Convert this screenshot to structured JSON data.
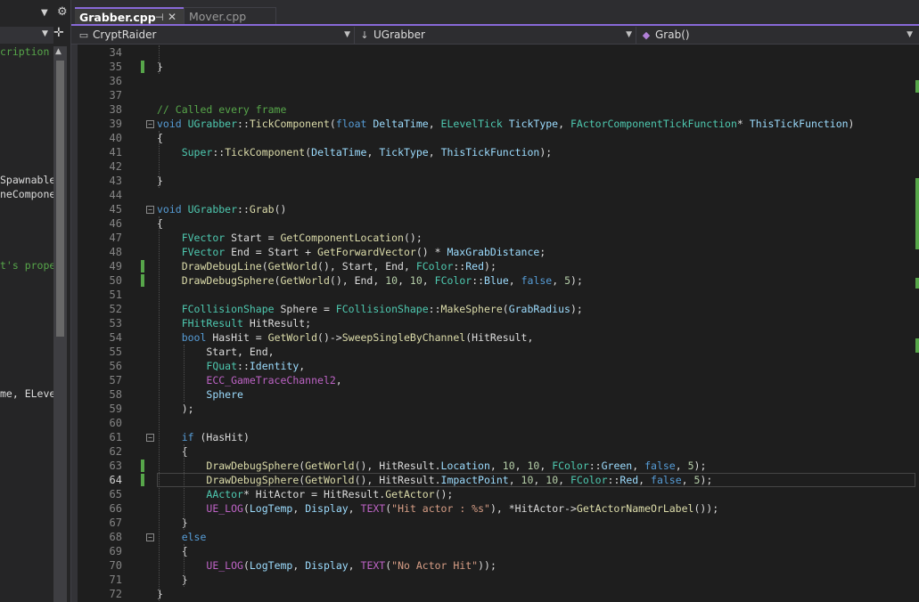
{
  "left_panel": {
    "fragments": [
      {
        "text": "cription",
        "color": "green"
      },
      {
        "text": "Spawnable",
        "color": "light"
      },
      {
        "text": "neCompone",
        "color": "light"
      },
      {
        "text": "t's prope",
        "color": "green"
      },
      {
        "text": "me, ELeve",
        "color": "light"
      }
    ]
  },
  "tabs": [
    {
      "label": "Grabber.cpp",
      "active": true
    },
    {
      "label": "Mover.cpp",
      "active": false
    }
  ],
  "navbar": {
    "project": "CryptRaider",
    "scope": "UGrabber",
    "member": "Grab()"
  },
  "editor": {
    "current_line": 64,
    "lines": [
      {
        "n": 34,
        "tokens": [
          [
            "d",
            ""
          ]
        ]
      },
      {
        "n": 35,
        "tokens": [
          [
            "d",
            "}"
          ]
        ]
      },
      {
        "n": 36,
        "tokens": []
      },
      {
        "n": 37,
        "tokens": []
      },
      {
        "n": 38,
        "tokens": [
          [
            "c",
            "// Called every frame"
          ]
        ]
      },
      {
        "n": 39,
        "tokens": [
          [
            "k",
            "void "
          ],
          [
            "t",
            "UGrabber"
          ],
          [
            "d",
            "::"
          ],
          [
            "f",
            "TickComponent"
          ],
          [
            "d",
            "("
          ],
          [
            "k",
            "float "
          ],
          [
            "p",
            "DeltaTime"
          ],
          [
            "d",
            ", "
          ],
          [
            "t",
            "ELevelTick "
          ],
          [
            "p",
            "TickType"
          ],
          [
            "d",
            ", "
          ],
          [
            "t",
            "FActorComponentTickFunction"
          ],
          [
            "d",
            "* "
          ],
          [
            "p",
            "ThisTickFunction"
          ],
          [
            "d",
            ")"
          ]
        ]
      },
      {
        "n": 40,
        "tokens": [
          [
            "d",
            "{"
          ]
        ]
      },
      {
        "n": 41,
        "tokens": [
          [
            "d",
            "    "
          ],
          [
            "t",
            "Super"
          ],
          [
            "d",
            "::"
          ],
          [
            "f",
            "TickComponent"
          ],
          [
            "d",
            "("
          ],
          [
            "p",
            "DeltaTime"
          ],
          [
            "d",
            ", "
          ],
          [
            "p",
            "TickType"
          ],
          [
            "d",
            ", "
          ],
          [
            "p",
            "ThisTickFunction"
          ],
          [
            "d",
            ");"
          ]
        ]
      },
      {
        "n": 42,
        "tokens": []
      },
      {
        "n": 43,
        "tokens": [
          [
            "d",
            "}"
          ]
        ]
      },
      {
        "n": 44,
        "tokens": []
      },
      {
        "n": 45,
        "tokens": [
          [
            "k",
            "void "
          ],
          [
            "t",
            "UGrabber"
          ],
          [
            "d",
            "::"
          ],
          [
            "f",
            "Grab"
          ],
          [
            "d",
            "()"
          ]
        ]
      },
      {
        "n": 46,
        "tokens": [
          [
            "d",
            "{"
          ]
        ]
      },
      {
        "n": 47,
        "tokens": [
          [
            "d",
            "    "
          ],
          [
            "t",
            "FVector "
          ],
          [
            "d",
            "Start = "
          ],
          [
            "f",
            "GetComponentLocation"
          ],
          [
            "d",
            "();"
          ]
        ]
      },
      {
        "n": 48,
        "tokens": [
          [
            "d",
            "    "
          ],
          [
            "t",
            "FVector "
          ],
          [
            "d",
            "End = Start + "
          ],
          [
            "f",
            "GetForwardVector"
          ],
          [
            "d",
            "() * "
          ],
          [
            "p",
            "MaxGrabDistance"
          ],
          [
            "d",
            ";"
          ]
        ]
      },
      {
        "n": 49,
        "tokens": [
          [
            "d",
            "    "
          ],
          [
            "f",
            "DrawDebugLine"
          ],
          [
            "d",
            "("
          ],
          [
            "f",
            "GetWorld"
          ],
          [
            "d",
            "(), Start, End, "
          ],
          [
            "t",
            "FColor"
          ],
          [
            "d",
            "::"
          ],
          [
            "p",
            "Red"
          ],
          [
            "d",
            ");"
          ]
        ]
      },
      {
        "n": 50,
        "tokens": [
          [
            "d",
            "    "
          ],
          [
            "f",
            "DrawDebugSphere"
          ],
          [
            "d",
            "("
          ],
          [
            "f",
            "GetWorld"
          ],
          [
            "d",
            "(), End, "
          ],
          [
            "n",
            "10"
          ],
          [
            "d",
            ", "
          ],
          [
            "n",
            "10"
          ],
          [
            "d",
            ", "
          ],
          [
            "t",
            "FColor"
          ],
          [
            "d",
            "::"
          ],
          [
            "p",
            "Blue"
          ],
          [
            "d",
            ", "
          ],
          [
            "k",
            "false"
          ],
          [
            "d",
            ", "
          ],
          [
            "n",
            "5"
          ],
          [
            "d",
            ");"
          ]
        ]
      },
      {
        "n": 51,
        "tokens": []
      },
      {
        "n": 52,
        "tokens": [
          [
            "d",
            "    "
          ],
          [
            "t",
            "FCollisionShape "
          ],
          [
            "d",
            "Sphere = "
          ],
          [
            "t",
            "FCollisionShape"
          ],
          [
            "d",
            "::"
          ],
          [
            "f",
            "MakeSphere"
          ],
          [
            "d",
            "("
          ],
          [
            "p",
            "GrabRadius"
          ],
          [
            "d",
            ");"
          ]
        ]
      },
      {
        "n": 53,
        "tokens": [
          [
            "d",
            "    "
          ],
          [
            "t",
            "FHitResult "
          ],
          [
            "d",
            "HitResult;"
          ]
        ]
      },
      {
        "n": 54,
        "tokens": [
          [
            "d",
            "    "
          ],
          [
            "k",
            "bool "
          ],
          [
            "d",
            "HasHit = "
          ],
          [
            "f",
            "GetWorld"
          ],
          [
            "d",
            "()->"
          ],
          [
            "f",
            "SweepSingleByChannel"
          ],
          [
            "d",
            "(HitResult,"
          ]
        ]
      },
      {
        "n": 55,
        "tokens": [
          [
            "d",
            "        Start, End,"
          ]
        ]
      },
      {
        "n": 56,
        "tokens": [
          [
            "d",
            "        "
          ],
          [
            "t",
            "FQuat"
          ],
          [
            "d",
            "::"
          ],
          [
            "p",
            "Identity"
          ],
          [
            "d",
            ","
          ]
        ]
      },
      {
        "n": 57,
        "tokens": [
          [
            "d",
            "        "
          ],
          [
            "m",
            "ECC_GameTraceChannel2"
          ],
          [
            "d",
            ","
          ]
        ]
      },
      {
        "n": 58,
        "tokens": [
          [
            "d",
            "        "
          ],
          [
            "p",
            "Sphere"
          ]
        ]
      },
      {
        "n": 59,
        "tokens": [
          [
            "d",
            "    );"
          ]
        ]
      },
      {
        "n": 60,
        "tokens": []
      },
      {
        "n": 61,
        "tokens": [
          [
            "d",
            "    "
          ],
          [
            "k",
            "if "
          ],
          [
            "d",
            "(HasHit)"
          ]
        ]
      },
      {
        "n": 62,
        "tokens": [
          [
            "d",
            "    {"
          ]
        ]
      },
      {
        "n": 63,
        "tokens": [
          [
            "d",
            "        "
          ],
          [
            "f",
            "DrawDebugSphere"
          ],
          [
            "d",
            "("
          ],
          [
            "f",
            "GetWorld"
          ],
          [
            "d",
            "(), HitResult."
          ],
          [
            "p",
            "Location"
          ],
          [
            "d",
            ", "
          ],
          [
            "n",
            "10"
          ],
          [
            "d",
            ", "
          ],
          [
            "n",
            "10"
          ],
          [
            "d",
            ", "
          ],
          [
            "t",
            "FColor"
          ],
          [
            "d",
            "::"
          ],
          [
            "p",
            "Green"
          ],
          [
            "d",
            ", "
          ],
          [
            "k",
            "false"
          ],
          [
            "d",
            ", "
          ],
          [
            "n",
            "5"
          ],
          [
            "d",
            ");"
          ]
        ]
      },
      {
        "n": 64,
        "tokens": [
          [
            "d",
            "        "
          ],
          [
            "f",
            "DrawDebugSphere"
          ],
          [
            "d",
            "("
          ],
          [
            "f",
            "GetWorld"
          ],
          [
            "d",
            "(), HitResult."
          ],
          [
            "p",
            "ImpactPoint"
          ],
          [
            "d",
            ", "
          ],
          [
            "n",
            "10"
          ],
          [
            "d",
            ", "
          ],
          [
            "n",
            "10"
          ],
          [
            "d",
            ", "
          ],
          [
            "t",
            "FColor"
          ],
          [
            "d",
            "::"
          ],
          [
            "p",
            "Red"
          ],
          [
            "d",
            ", "
          ],
          [
            "k",
            "false"
          ],
          [
            "d",
            ", "
          ],
          [
            "n",
            "5"
          ],
          [
            "d",
            ");"
          ]
        ]
      },
      {
        "n": 65,
        "tokens": [
          [
            "d",
            "        "
          ],
          [
            "t",
            "AActor"
          ],
          [
            "d",
            "* HitActor = HitResult."
          ],
          [
            "f",
            "GetActor"
          ],
          [
            "d",
            "();"
          ]
        ]
      },
      {
        "n": 66,
        "tokens": [
          [
            "d",
            "        "
          ],
          [
            "m",
            "UE_LOG"
          ],
          [
            "d",
            "("
          ],
          [
            "p",
            "LogTemp"
          ],
          [
            "d",
            ", "
          ],
          [
            "p",
            "Display"
          ],
          [
            "d",
            ", "
          ],
          [
            "m",
            "TEXT"
          ],
          [
            "d",
            "("
          ],
          [
            "s",
            "\"Hit actor : %s\""
          ],
          [
            "d",
            "), *HitActor->"
          ],
          [
            "f",
            "GetActorNameOrLabel"
          ],
          [
            "d",
            "());"
          ]
        ]
      },
      {
        "n": 67,
        "tokens": [
          [
            "d",
            "    }"
          ]
        ]
      },
      {
        "n": 68,
        "tokens": [
          [
            "d",
            "    "
          ],
          [
            "k",
            "else"
          ]
        ]
      },
      {
        "n": 69,
        "tokens": [
          [
            "d",
            "    {"
          ]
        ]
      },
      {
        "n": 70,
        "tokens": [
          [
            "d",
            "        "
          ],
          [
            "m",
            "UE_LOG"
          ],
          [
            "d",
            "("
          ],
          [
            "p",
            "LogTemp"
          ],
          [
            "d",
            ", "
          ],
          [
            "p",
            "Display"
          ],
          [
            "d",
            ", "
          ],
          [
            "m",
            "TEXT"
          ],
          [
            "d",
            "("
          ],
          [
            "s",
            "\"No Actor Hit\""
          ],
          [
            "d",
            "));"
          ]
        ]
      },
      {
        "n": 71,
        "tokens": [
          [
            "d",
            "    }"
          ]
        ]
      },
      {
        "n": 72,
        "tokens": [
          [
            "d",
            "}"
          ]
        ]
      }
    ],
    "colors": {
      "keyword": "#569cd6",
      "type": "#4ec9b0",
      "function": "#dcdcaa",
      "string": "#d69d85",
      "comment": "#57a64a",
      "number": "#b5cea8",
      "macro": "#bd63c5",
      "identifier": "#9cdcfe",
      "change_marker": "#57a64a",
      "tab_accent": "#8869d8"
    }
  }
}
